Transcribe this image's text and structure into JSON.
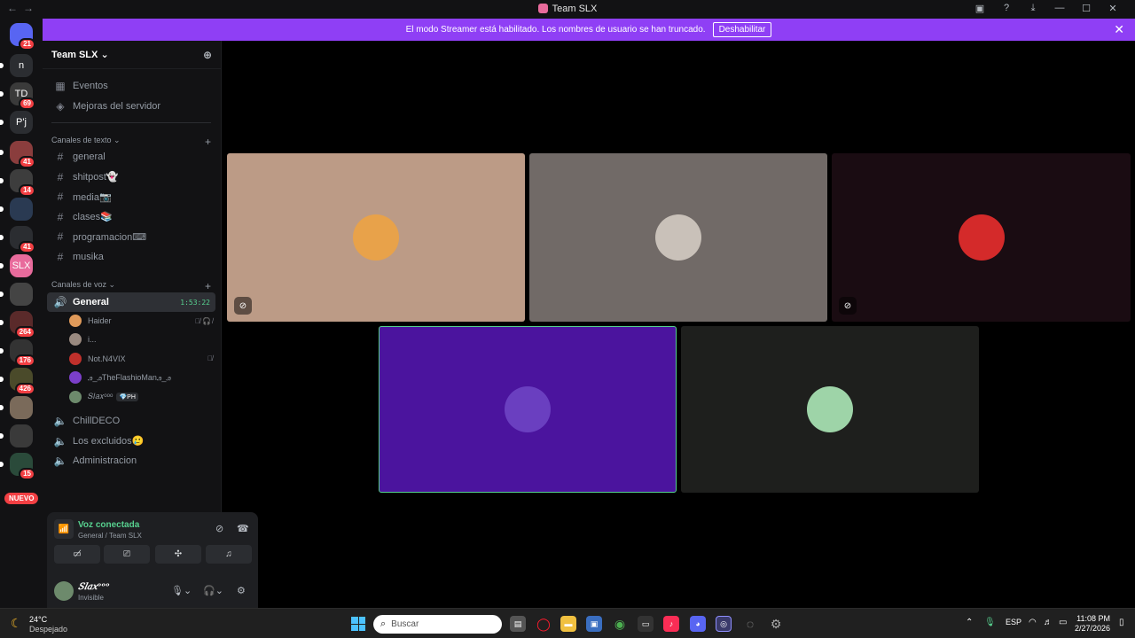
{
  "window": {
    "title": "Team SLX"
  },
  "banner": {
    "text": "El modo Streamer está habilitado. Los nombres de usuario se han truncado.",
    "button": "Deshabilitar"
  },
  "guilds": [
    {
      "label": "",
      "badge": "21",
      "color": "#5865f2"
    },
    {
      "label": "n",
      "badge": "",
      "color": "#2b2d31"
    },
    {
      "label": "TD",
      "badge": "69",
      "color": "#3a3a3a"
    },
    {
      "label": "P'j",
      "badge": "",
      "color": "#2b2d31"
    },
    {
      "label": "",
      "badge": "41",
      "color": "#8a3d3d"
    },
    {
      "label": "",
      "badge": "14",
      "color": "#3d3d3d"
    },
    {
      "label": "",
      "badge": "",
      "color": "#2a3a52"
    },
    {
      "label": "",
      "badge": "41",
      "color": "#2b2d31"
    },
    {
      "label": "SLX",
      "badge": "",
      "color": "#e86b9c"
    },
    {
      "label": "",
      "badge": "",
      "color": "#444"
    },
    {
      "label": "",
      "badge": "264",
      "color": "#5a2a2a"
    },
    {
      "label": "",
      "badge": "176",
      "color": "#333"
    },
    {
      "label": "",
      "badge": "426",
      "color": "#4a4a2a"
    },
    {
      "label": "",
      "badge": "",
      "color": "#7a6a5a"
    },
    {
      "label": "",
      "badge": "",
      "color": "#3a3a3a"
    },
    {
      "label": "",
      "badge": "15",
      "color": "#2a4a3a"
    }
  ],
  "guild_new": "NUEVO",
  "server": {
    "name": "Team SLX",
    "top_items": [
      {
        "label": "Eventos"
      },
      {
        "label": "Mejoras del servidor"
      }
    ],
    "text_category": "Canales de texto",
    "text_channels": [
      "general",
      "shitpost👻",
      "media📷",
      "clases📚",
      "programacion⌨",
      "musika"
    ],
    "voice_category": "Canales de voz",
    "active_voice": {
      "name": "General",
      "timer": "1:53:22"
    },
    "members": [
      {
        "name": "Haider",
        "color": "#e09a5a",
        "icons": "🎙̸🎧̸",
        "ph": ""
      },
      {
        "name": "i...",
        "color": "#9a8a80",
        "icons": "",
        "ph": ""
      },
      {
        "name": "Not.N4VIX",
        "color": "#c0302b",
        "icons": "🎙̸",
        "ph": ""
      },
      {
        "name": "ꭿ_ꭿTheFlashioManꭿ_ꭿ",
        "color": "#7b3fc9",
        "icons": "",
        "ph": ""
      },
      {
        "name": "𝑆𝑙𝑎𝑥ᵒᵒᵒ",
        "color": "#6d8a6c",
        "icons": "",
        "ph": "💎PH"
      }
    ],
    "other_voice": [
      "ChillDECO",
      "Los excluidos🥲",
      "Administracion"
    ]
  },
  "voice_panel": {
    "status": "Voz conectada",
    "channel": "General / Team SLX"
  },
  "user": {
    "name": "𝑆𝑙𝑎𝑥ᵒᵒᵒ",
    "status": "Invisible"
  },
  "tiles": [
    {
      "bg": "#bc9b86",
      "avatar": "#e8a24a",
      "muted": true,
      "mute_icon": "⊘"
    },
    {
      "bg": "#716a67",
      "avatar": "#c9c1b9",
      "muted": false,
      "mute_icon": ""
    },
    {
      "bg": "#1a0c12",
      "avatar": "#d42a2a",
      "muted": true,
      "mute_icon": "⊘"
    },
    {
      "bg": "#4b149e",
      "avatar": "#6a3fc0",
      "muted": false,
      "mute_icon": "",
      "speaking": true
    },
    {
      "bg": "#1e1f1d",
      "avatar": "#9ed4a8",
      "muted": false,
      "mute_icon": ""
    }
  ],
  "taskbar": {
    "weather_temp": "24°C",
    "weather_desc": "Despejado",
    "search_placeholder": "Buscar",
    "lang": "ESP",
    "time": "11:08 PM",
    "date": "2/27/2026"
  }
}
